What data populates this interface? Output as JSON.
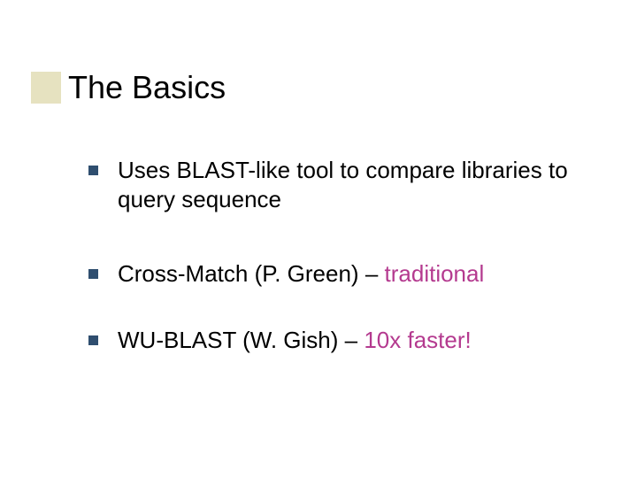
{
  "title": "The Basics",
  "bullets": [
    {
      "pre": "Uses BLAST-like tool to compare libraries to query sequence",
      "highlight": "",
      "post": ""
    },
    {
      "pre": "Cross-Match (P. Green) – ",
      "highlight": "traditional",
      "post": ""
    },
    {
      "pre": "WU-BLAST (W. Gish) – ",
      "highlight": "10x faster!",
      "post": ""
    }
  ],
  "colors": {
    "accent_block": "#e6e2c0",
    "bullet_marker": "#2f4e6f",
    "highlight": "#b43a8f"
  }
}
